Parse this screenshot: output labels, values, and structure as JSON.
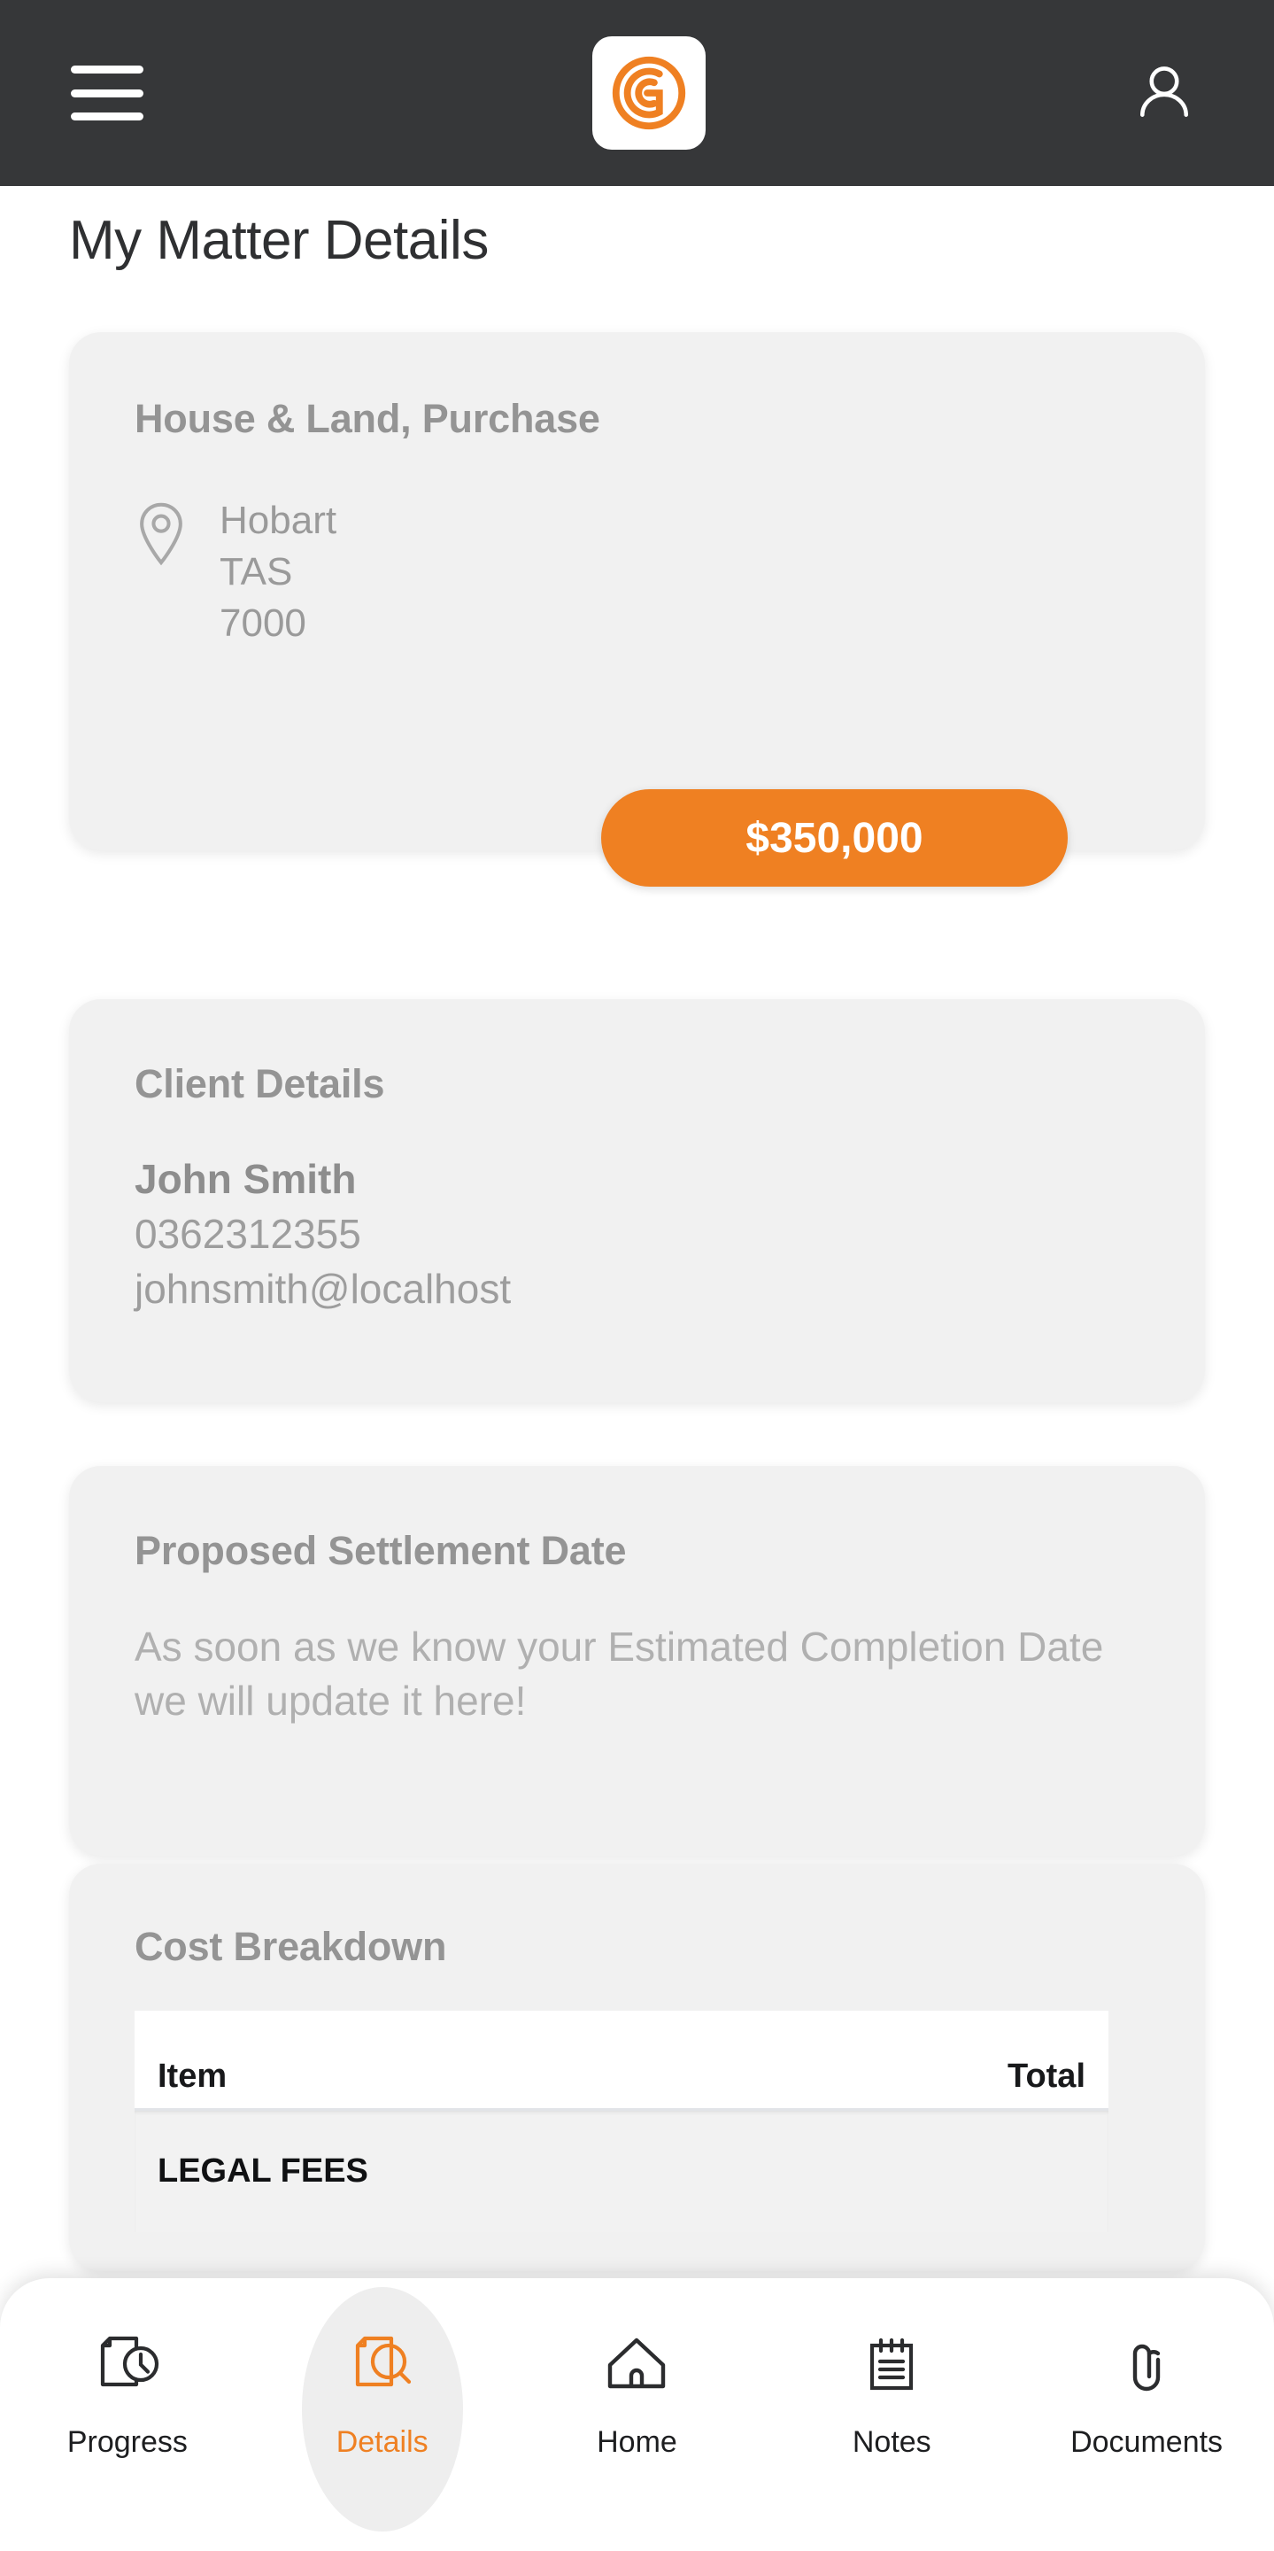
{
  "appbar": {
    "menu_icon": "hamburger-menu-icon",
    "logo_icon": "brand-g-logo-icon",
    "profile_icon": "user-profile-icon",
    "background_color": "#363739"
  },
  "page_title": "My Matter Details",
  "matter_card": {
    "title": "House & Land, Purchase",
    "location_icon": "map-pin-icon",
    "address_lines": [
      "Hobart",
      "TAS",
      "7000"
    ],
    "price": "$350,000",
    "price_color": "#ef8022"
  },
  "client_card": {
    "title": "Client Details",
    "name": "John Smith",
    "phone": "0362312355",
    "email": "johnsmith@localhost"
  },
  "settlement_card": {
    "title": "Proposed Settlement Date",
    "body": "As soon as we know your Estimated Completion Date we will update it here!"
  },
  "cost_card": {
    "title": "Cost Breakdown",
    "columns": [
      "Item",
      "Total"
    ],
    "rows": [
      {
        "item": "LEGAL FEES",
        "total": ""
      }
    ]
  },
  "bottom_nav": {
    "active_color": "#ef8022",
    "items": [
      {
        "label": "Progress",
        "icon": "document-clock-icon",
        "active": false
      },
      {
        "label": "Details",
        "icon": "document-search-icon",
        "active": true
      },
      {
        "label": "Home",
        "icon": "home-icon",
        "active": false
      },
      {
        "label": "Notes",
        "icon": "notepad-icon",
        "active": false
      },
      {
        "label": "Documents",
        "icon": "paperclip-icon",
        "active": false
      }
    ]
  }
}
